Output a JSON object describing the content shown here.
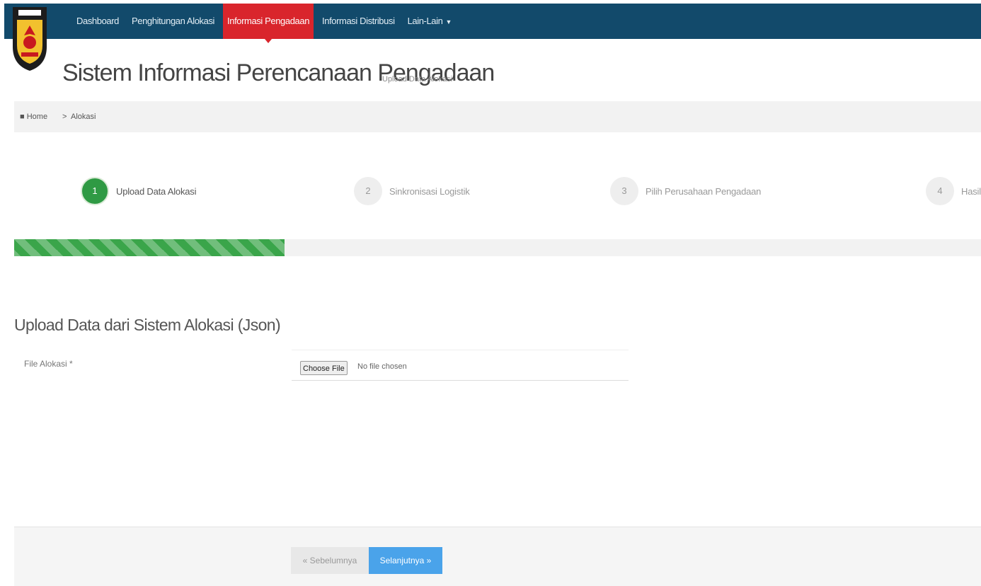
{
  "navbar": {
    "items": [
      {
        "label": "Dashboard"
      },
      {
        "label": "Penghitungan Alokasi"
      },
      {
        "label": "Informasi Pengadaan"
      },
      {
        "label": "Informasi Distribusi"
      },
      {
        "label": "Lain-Lain"
      }
    ],
    "active_index": 2,
    "colors": {
      "background": "#124a6b",
      "active": "#d9252c"
    }
  },
  "logo": {
    "icon": "kpu-garuda-emblem-icon"
  },
  "header": {
    "title": "Sistem Informasi Perencanaan Pengadaan",
    "subtitle": "Upload Data Alokasi"
  },
  "breadcrumb": {
    "home_label": "Home",
    "separator": ">",
    "current": "Alokasi"
  },
  "wizard": {
    "steps": [
      {
        "number": "1",
        "label": "Upload Data Alokasi"
      },
      {
        "number": "2",
        "label": "Sinkronisasi Logistik"
      },
      {
        "number": "3",
        "label": "Pilih Perusahaan Pengadaan"
      },
      {
        "number": "4",
        "label": "Hasil"
      }
    ],
    "active_step": 1,
    "progress_fraction": 0.28,
    "colors": {
      "active": "#2f9a44",
      "progress": "#3aa54a"
    }
  },
  "form": {
    "section_title": "Upload Data dari Sistem Alokasi (Json)",
    "field_label": "File Alokasi *",
    "choose_button": "Choose File",
    "no_file_text": "No file chosen"
  },
  "footer": {
    "prev_label": "« Sebelumnya",
    "next_label": "Selanjutnya »",
    "colors": {
      "next": "#4aa3ea"
    }
  }
}
